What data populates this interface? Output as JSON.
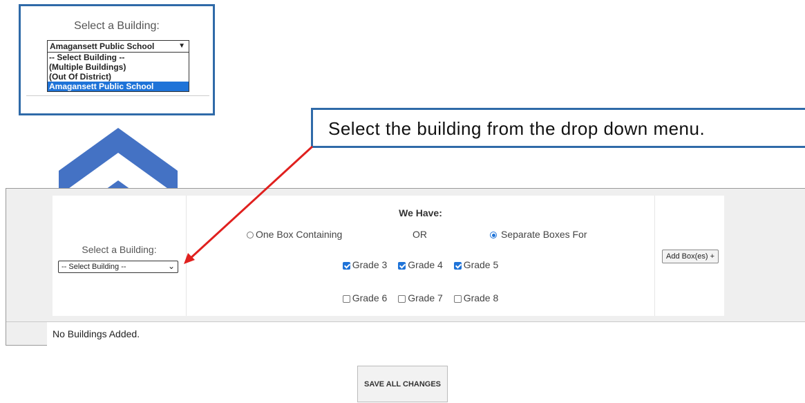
{
  "zoom_callout": {
    "title": "Select a Building:",
    "selected": "Amagansett Public School",
    "options": [
      "-- Select Building --",
      "(Multiple Buildings)",
      "(Out Of District)",
      "Amagansett Public School"
    ],
    "selected_index": 3
  },
  "instruction": "Select the building from the drop down menu.",
  "form": {
    "building_label": "Select a Building:",
    "building_select_value": "-- Select Building --",
    "we_have_label": "We Have:",
    "radio_one_box": "One Box Containing",
    "or_text": "OR",
    "radio_separate": "Separate Boxes For",
    "grades_row1": [
      {
        "label": "Grade 3",
        "checked": true
      },
      {
        "label": "Grade 4",
        "checked": true
      },
      {
        "label": "Grade 5",
        "checked": true
      }
    ],
    "grades_row2": [
      {
        "label": "Grade 6",
        "checked": false
      },
      {
        "label": "Grade 7",
        "checked": false
      },
      {
        "label": "Grade 8",
        "checked": false
      }
    ],
    "add_button": "Add Box(es) +",
    "no_buildings": "No Buildings Added."
  },
  "save_button": "SAVE ALL CHANGES",
  "colors": {
    "accent_blue": "#1e73d8",
    "callout_border": "#2f6aa8",
    "chevron": "#4472c4",
    "arrow_red": "#e0201e"
  }
}
